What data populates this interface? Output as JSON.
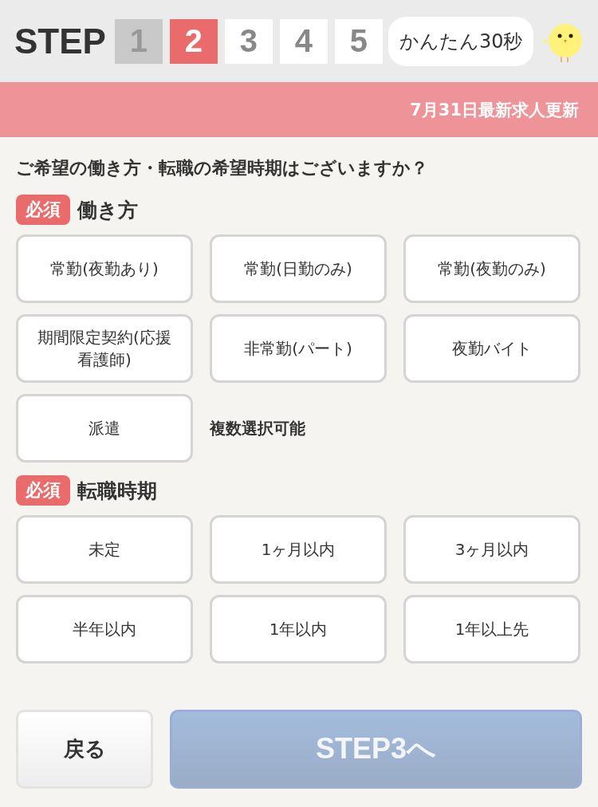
{
  "header": {
    "step_label": "STEP",
    "steps": [
      {
        "label": "1",
        "completed": true,
        "selected": false
      },
      {
        "label": "2",
        "completed": false,
        "selected": true
      },
      {
        "label": "3",
        "completed": false,
        "selected": false
      },
      {
        "label": "4",
        "completed": false,
        "selected": false
      },
      {
        "label": "5",
        "completed": false,
        "selected": false
      }
    ],
    "bubble": "かんたん30秒"
  },
  "banner": "7月31日最新求人更新",
  "question": "ご希望の働き方・転職の希望時期はございますか？",
  "sections": [
    {
      "badge": "必須",
      "title": "働き方",
      "note": "複数選択可能",
      "options": [
        {
          "label": "常勤(夜勤あり)",
          "selected": false
        },
        {
          "label": "常勤(日勤のみ)",
          "selected": false
        },
        {
          "label": "常勤(夜勤のみ)",
          "selected": false
        },
        {
          "label": "期間限定契約(応援看護師)",
          "selected": false
        },
        {
          "label": "非常勤(パート)",
          "selected": false
        },
        {
          "label": "夜勤バイト",
          "selected": false
        },
        {
          "label": "派遣",
          "selected": false
        }
      ]
    },
    {
      "badge": "必須",
      "title": "転職時期",
      "options": [
        {
          "label": "未定",
          "selected": false
        },
        {
          "label": "1ヶ月以内",
          "selected": false
        },
        {
          "label": "3ヶ月以内",
          "selected": false
        },
        {
          "label": "半年以内",
          "selected": false
        },
        {
          "label": "1年以内",
          "selected": false
        },
        {
          "label": "1年以上先",
          "selected": false
        }
      ]
    }
  ],
  "footer": {
    "back": "戻る",
    "next": {
      "label": "STEP3へ",
      "disabled": true
    }
  }
}
